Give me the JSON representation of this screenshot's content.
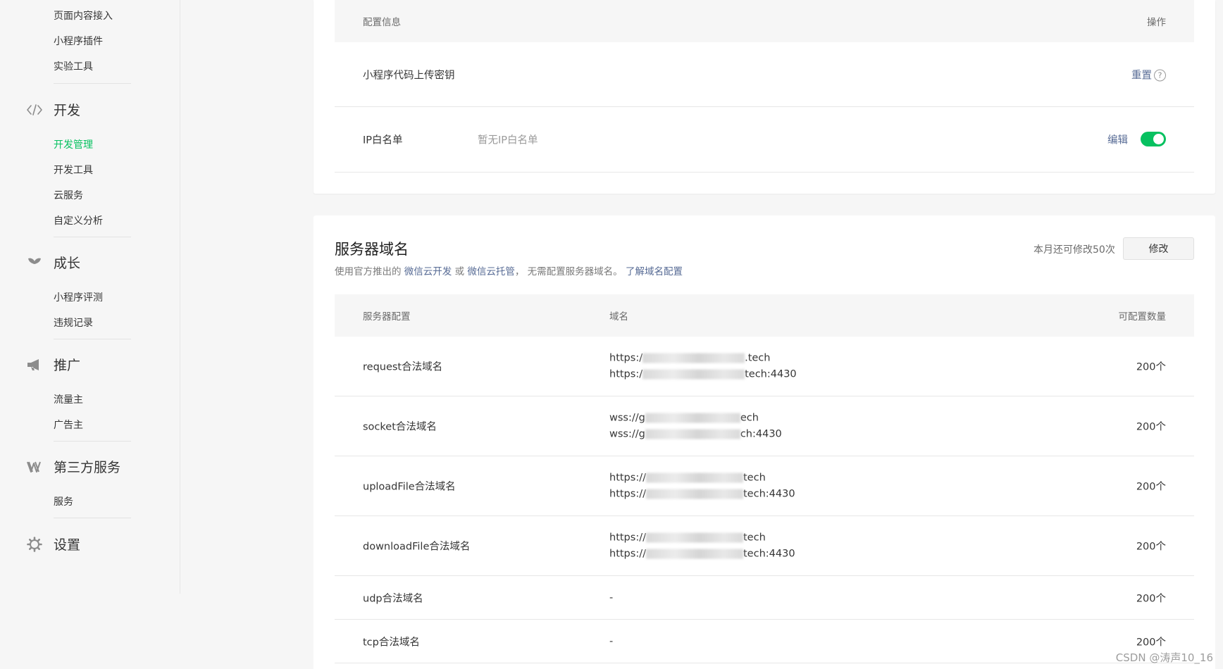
{
  "sidebar": {
    "top_items": [
      "页面内容接入",
      "小程序插件",
      "实验工具"
    ],
    "sections": [
      {
        "label": "开发",
        "icon": "code-icon",
        "items": [
          "开发管理",
          "开发工具",
          "云服务",
          "自定义分析"
        ]
      },
      {
        "label": "成长",
        "icon": "sprout-icon",
        "items": [
          "小程序评测",
          "违规记录"
        ]
      },
      {
        "label": "推广",
        "icon": "megaphone-icon",
        "items": [
          "流量主",
          "广告主"
        ]
      },
      {
        "label": "第三方服务",
        "icon": "third-party-icon",
        "items": [
          "服务"
        ]
      },
      {
        "label": "设置",
        "icon": "gear-icon",
        "items": []
      }
    ],
    "active_item": "开发管理"
  },
  "config_card": {
    "header": {
      "info": "配置信息",
      "action": "操作"
    },
    "rows": [
      {
        "label": "小程序代码上传密钥",
        "value": "",
        "action": "重置"
      },
      {
        "label": "IP白名单",
        "value": "暂无IP白名单",
        "action": "编辑",
        "toggle_on": true
      }
    ]
  },
  "server_card": {
    "title": "服务器域名",
    "desc_prefix": "使用官方推出的",
    "desc_link1": "微信云开发",
    "desc_or": "或",
    "desc_link2": "微信云托管",
    "desc_suffix": "， 无需配置服务器域名。",
    "desc_link3": "了解域名配置",
    "quota": "本月还可修改50次",
    "modify_button": "修改",
    "header": {
      "config": "服务器配置",
      "domain": "域名",
      "count": "可配置数量"
    },
    "rows": [
      {
        "name": "request合法域名",
        "domains": [
          {
            "prefix": "https:/",
            "suffix": ".tech"
          },
          {
            "prefix": "https:/",
            "suffix": "tech:4430"
          }
        ],
        "count": "200个"
      },
      {
        "name": "socket合法域名",
        "domains": [
          {
            "prefix": "wss://g",
            "suffix": "ech"
          },
          {
            "prefix": "wss://g",
            "suffix": "ch:4430"
          }
        ],
        "count": "200个"
      },
      {
        "name": "uploadFile合法域名",
        "domains": [
          {
            "prefix": "https://",
            "suffix": "tech"
          },
          {
            "prefix": "https://",
            "suffix": "tech:4430"
          }
        ],
        "count": "200个"
      },
      {
        "name": "downloadFile合法域名",
        "domains": [
          {
            "prefix": "https://",
            "suffix": "tech"
          },
          {
            "prefix": "https://",
            "suffix": "tech:4430"
          }
        ],
        "count": "200个"
      },
      {
        "name": "udp合法域名",
        "domain_text": "-",
        "count": "200个"
      },
      {
        "name": "tcp合法域名",
        "domain_text": "-",
        "count": "200个"
      }
    ]
  },
  "watermark": "CSDN @涛声10_16"
}
